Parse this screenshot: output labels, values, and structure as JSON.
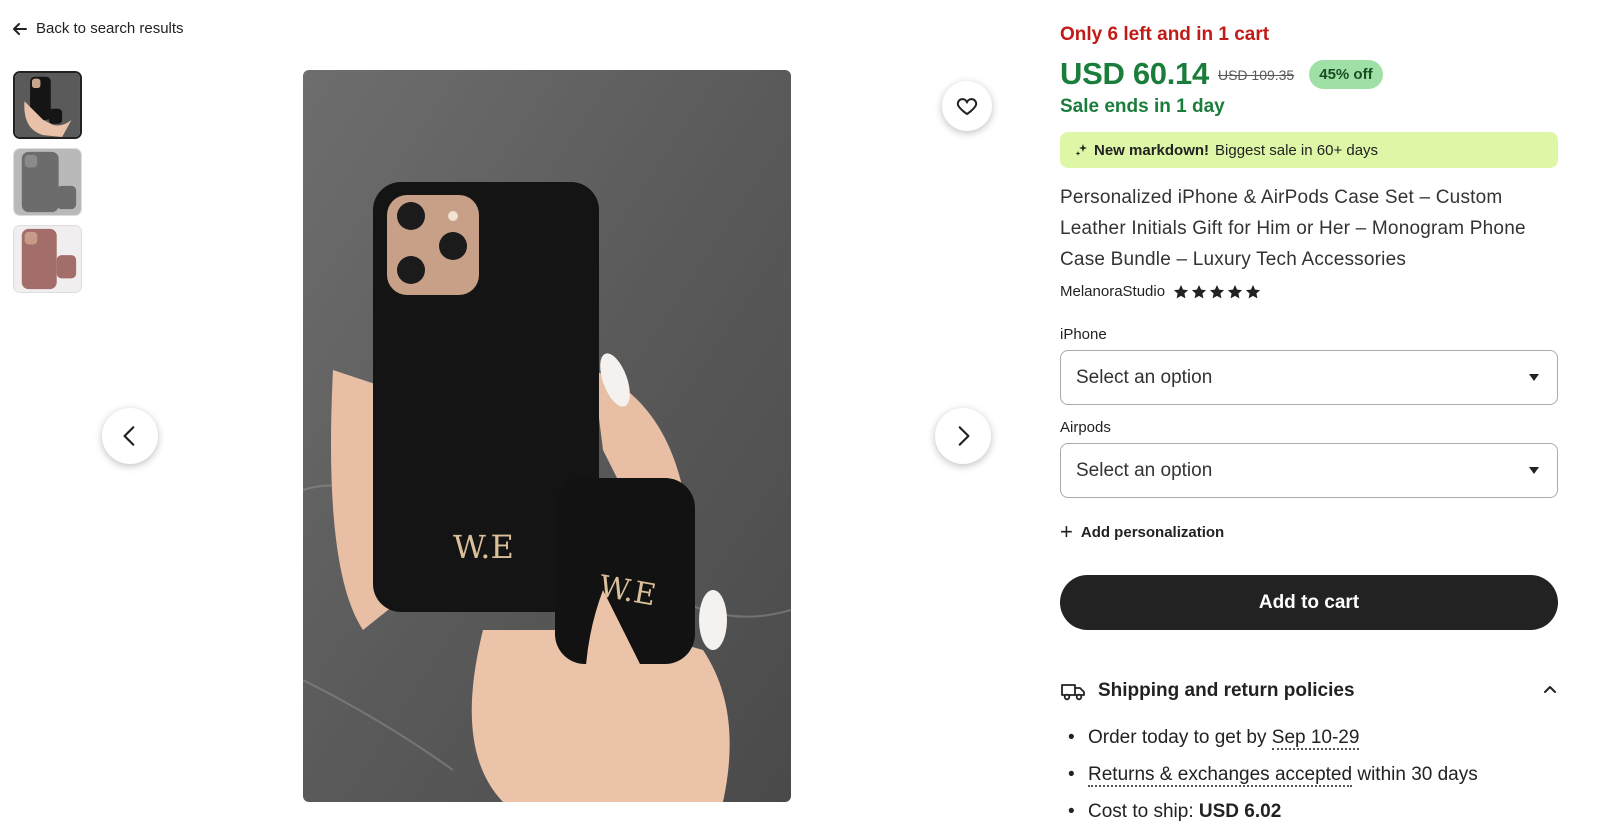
{
  "nav": {
    "back_label": "Back to search results"
  },
  "gallery": {
    "thumbnails": [
      {
        "name": "black case set"
      },
      {
        "name": "grey case set"
      },
      {
        "name": "rose case set"
      }
    ],
    "photo_monogram": "W.E"
  },
  "product": {
    "stock_message": "Only 6 left and in 1 cart",
    "price": "USD 60.14",
    "original_price": "USD 109.35",
    "discount_badge": "45% off",
    "sale_ends": "Sale ends in 1 day",
    "markdown_bold": "New markdown!",
    "markdown_text": "Biggest sale in 60+ days",
    "title": "Personalized iPhone & AirPods Case Set – Custom Leather Initials Gift for Him or Her – Monogram Phone Case Bundle – Luxury Tech Accessories",
    "shop_name": "MelanoraStudio",
    "rating_stars": 5
  },
  "options": {
    "iphone_label": "iPhone",
    "iphone_value": "Select an option",
    "airpods_label": "Airpods",
    "airpods_value": "Select an option"
  },
  "personalization_label": "Add personalization",
  "cart_button_label": "Add to cart",
  "shipping": {
    "heading": "Shipping and return policies",
    "order_prefix": "Order today to get by ",
    "order_date": "Sep 10-29",
    "returns_link": "Returns & exchanges accepted",
    "returns_suffix": " within 30 days",
    "cost_prefix": "Cost to ship: ",
    "cost_value": "USD 6.02"
  },
  "colors": {
    "price_green": "#1b7d3b",
    "stock_red": "#c11b17",
    "badge_green": "#9ee0a6",
    "markdown_bg": "#def7a6",
    "cart_bg": "#222222"
  }
}
